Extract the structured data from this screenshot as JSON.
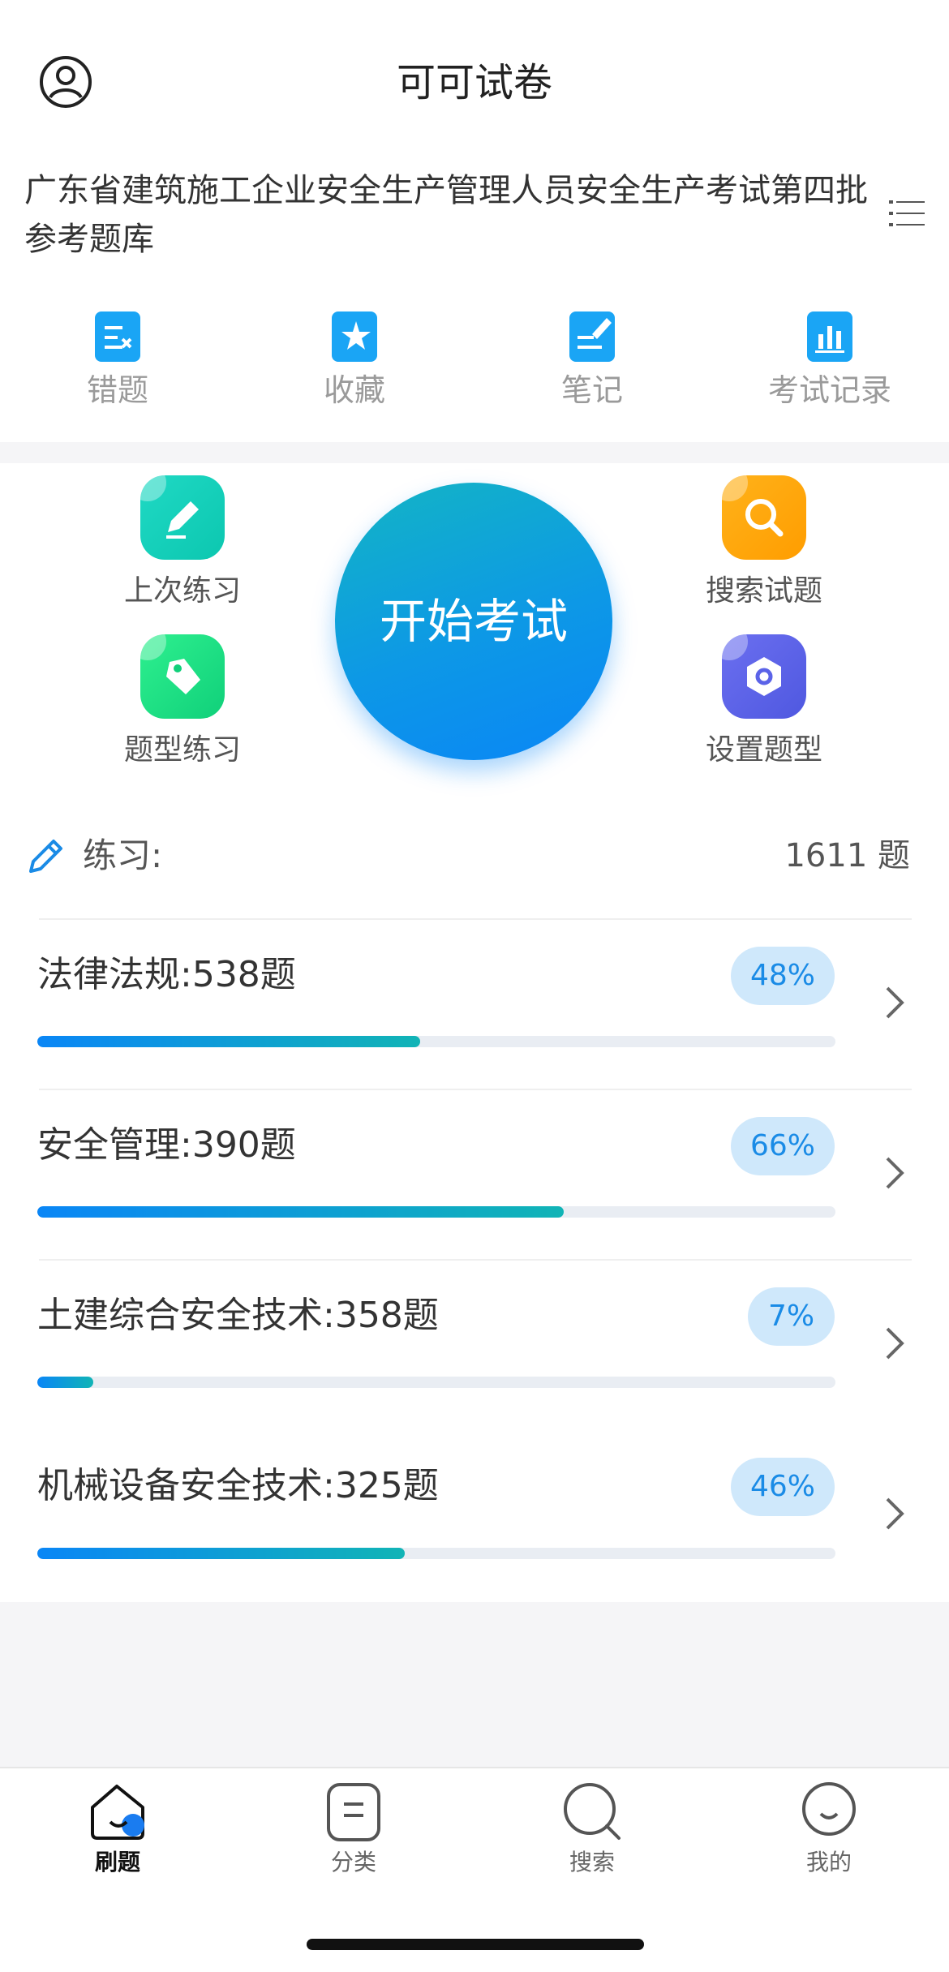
{
  "header": {
    "title": "可可试卷",
    "bank_title": "广东省建筑施工企业安全生产管理人员安全生产考试第四批参考题库"
  },
  "quick_links": [
    {
      "label": "错题",
      "icon": "wrong-questions-icon"
    },
    {
      "label": "收藏",
      "icon": "favorites-icon"
    },
    {
      "label": "笔记",
      "icon": "notes-icon"
    },
    {
      "label": "考试记录",
      "icon": "exam-record-icon"
    }
  ],
  "features": {
    "last_practice": "上次练习",
    "type_practice": "题型练习",
    "search_questions": "搜索试题",
    "set_question_type": "设置题型",
    "start_exam": "开始考试"
  },
  "practice": {
    "label": "练习:",
    "total": "1611 题"
  },
  "categories": [
    {
      "name": "法律法规:538题",
      "percent_label": "48%",
      "progress": 0.48
    },
    {
      "name": "安全管理:390题",
      "percent_label": "66%",
      "progress": 0.66
    },
    {
      "name": "土建综合安全技术:358题",
      "percent_label": "7%",
      "progress": 0.07
    },
    {
      "name": "机械设备安全技术:325题",
      "percent_label": "46%",
      "progress": 0.46
    }
  ],
  "tabs": [
    {
      "label": "刷题",
      "active": true
    },
    {
      "label": "分类",
      "active": false
    },
    {
      "label": "搜索",
      "active": false
    },
    {
      "label": "我的",
      "active": false
    }
  ],
  "colors": {
    "accent": "#0a86f6",
    "teal": "#11b4b6",
    "orange": "#ffa500",
    "green": "#10d88a",
    "indigo": "#5b63e8"
  }
}
